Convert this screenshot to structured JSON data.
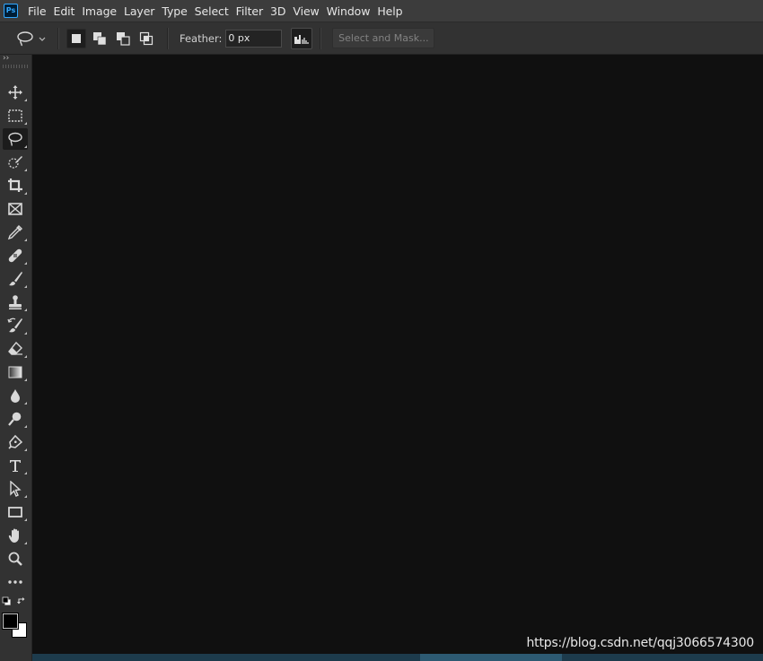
{
  "app": {
    "logo_text": "Ps"
  },
  "menu": [
    "File",
    "Edit",
    "Image",
    "Layer",
    "Type",
    "Select",
    "Filter",
    "3D",
    "View",
    "Window",
    "Help"
  ],
  "options": {
    "active_tool_icon": "lasso-icon",
    "modes": [
      "new-selection-icon",
      "add-to-selection-icon",
      "subtract-from-selection-icon",
      "intersect-selection-icon"
    ],
    "feather_label": "Feather:",
    "feather_value": "0 px",
    "select_mask_label": "Select and Mask..."
  },
  "toolbar": {
    "collapse_glyph": "››",
    "tools": [
      "move-icon",
      "rect-marquee-icon",
      "lasso-icon",
      "quick-select-icon",
      "crop-icon",
      "frame-icon",
      "eyedropper-icon",
      "healing-brush-icon",
      "brush-icon",
      "clone-stamp-icon",
      "history-brush-icon",
      "eraser-icon",
      "gradient-icon",
      "blur-icon",
      "dodge-icon",
      "pen-icon",
      "type-icon",
      "path-select-icon",
      "rectangle-icon",
      "hand-icon",
      "zoom-icon",
      "more-tools-icon"
    ],
    "active_tool": "lasso-icon",
    "foreground_color": "#000000",
    "background_color": "#ffffff"
  },
  "watermark": "https://blog.csdn.net/qqj3066574300"
}
